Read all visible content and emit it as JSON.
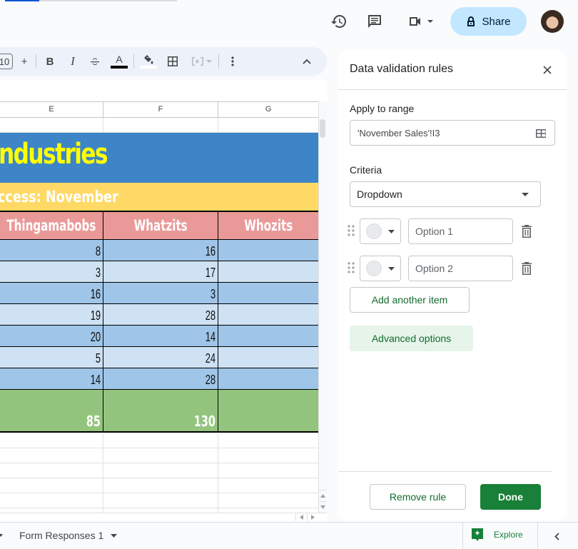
{
  "top_progress": {
    "fraction": 0.2
  },
  "topbar": {
    "icons": [
      "version-history-icon",
      "comments-icon",
      "meet-icon"
    ],
    "share_label": "Share"
  },
  "toolbar": {
    "font_size_value": "10",
    "plus_label": "+",
    "bold_label": "B",
    "italic_label": "I",
    "text_color_label": "A",
    "text_color_hex": "#000000",
    "fill_color_hex": "#ffffff"
  },
  "sheet": {
    "columns": [
      "E",
      "F",
      "G"
    ],
    "title": "ndustries",
    "subtitle": "ccess: November",
    "headers": [
      "Thingamabobs",
      "Whatzits",
      "Whozits"
    ],
    "rows": [
      [
        "8",
        "16",
        ""
      ],
      [
        "3",
        "17",
        ""
      ],
      [
        "16",
        "3",
        ""
      ],
      [
        "19",
        "28",
        ""
      ],
      [
        "20",
        "14",
        ""
      ],
      [
        "5",
        "24",
        ""
      ],
      [
        "14",
        "28",
        ""
      ]
    ],
    "totals": [
      "85",
      "130",
      ""
    ],
    "colors": {
      "title_bg": "#3d85c6",
      "title_text": "#ffff00",
      "subtitle_bg": "#ffd966",
      "header_bg": "#ea9999",
      "row_dark": "#9fc5e8",
      "row_light": "#cfe2f3",
      "total_bg": "#93c47d"
    }
  },
  "panel": {
    "title": "Data validation rules",
    "apply_label": "Apply to range",
    "range_value": "'November Sales'!I3",
    "criteria_label": "Criteria",
    "criteria_value": "Dropdown",
    "options": [
      {
        "placeholder": "Option 1"
      },
      {
        "placeholder": "Option 2"
      }
    ],
    "add_item_label": "Add another item",
    "advanced_label": "Advanced options",
    "remove_label": "Remove rule",
    "done_label": "Done"
  },
  "bottombar": {
    "sheet_tab": "Form Responses 1",
    "explore_label": "Explore"
  }
}
